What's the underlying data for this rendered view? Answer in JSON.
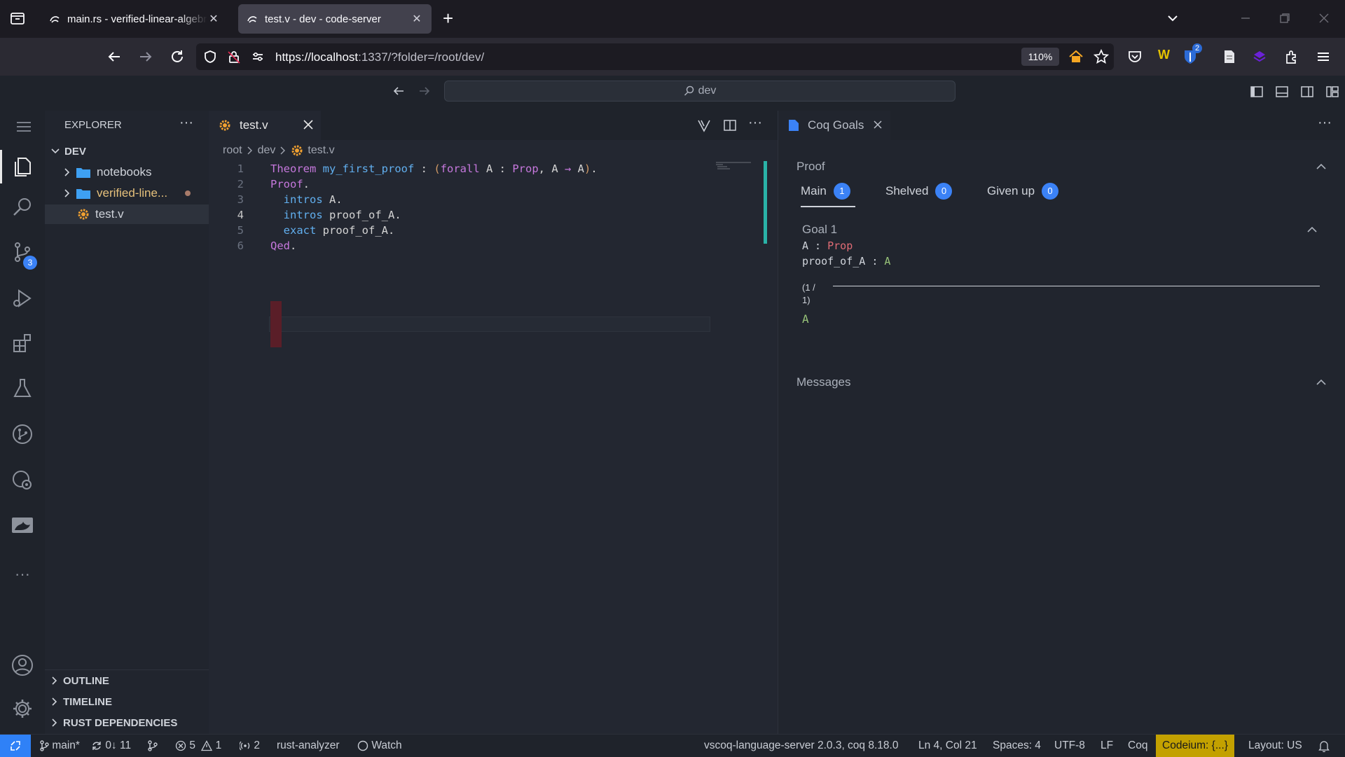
{
  "browser": {
    "tabs": [
      {
        "title": "main.rs - verified-linear-algebra",
        "active": false
      },
      {
        "title": "test.v - dev - code-server",
        "active": true
      }
    ],
    "url_host": "https://localhost",
    "url_rest": ":1337/?folder=/root/dev/",
    "zoom": "110%",
    "extension_badge": "2"
  },
  "command_center": {
    "text": "dev"
  },
  "activity_bar": {
    "items": [
      "explorer",
      "search",
      "source-control",
      "run-debug",
      "extensions",
      "testing",
      "git-graph",
      "remote",
      "coq"
    ],
    "scm_badge": "3"
  },
  "sidebar": {
    "title": "EXPLORER",
    "root_folder": "DEV",
    "tree": [
      {
        "label": "notebooks",
        "type": "folder"
      },
      {
        "label": "verified-line...",
        "type": "folder",
        "modified": true
      },
      {
        "label": "test.v",
        "type": "file",
        "selected": true
      }
    ],
    "sections": [
      "OUTLINE",
      "TIMELINE",
      "RUST DEPENDENCIES"
    ]
  },
  "editor": {
    "tab_label": "test.v",
    "breadcrumb": [
      "root",
      "dev",
      "test.v"
    ],
    "lines": [
      {
        "n": "1",
        "tokens": [
          [
            "kw",
            "Theorem"
          ],
          [
            "pl",
            " "
          ],
          [
            "fn",
            "my_first_proof"
          ],
          [
            "pl",
            " : "
          ],
          [
            "pu",
            "("
          ],
          [
            "kw",
            "forall"
          ],
          [
            "pl",
            " A : "
          ],
          [
            "ty",
            "Prop"
          ],
          [
            "pl",
            ", A "
          ],
          [
            "kw",
            "→"
          ],
          [
            "pl",
            " A"
          ],
          [
            "pu",
            ")"
          ],
          [
            "pl",
            "."
          ]
        ]
      },
      {
        "n": "2",
        "tokens": [
          [
            "kw",
            "Proof"
          ],
          [
            "pl",
            "."
          ]
        ]
      },
      {
        "n": "3",
        "tokens": [
          [
            "pl",
            "  "
          ],
          [
            "fn",
            "intros"
          ],
          [
            "pl",
            " A."
          ]
        ]
      },
      {
        "n": "4",
        "tokens": [
          [
            "pl",
            "  "
          ],
          [
            "fn",
            "intros"
          ],
          [
            "pl",
            " proof_of_A."
          ]
        ]
      },
      {
        "n": "5",
        "tokens": [
          [
            "pl",
            "  "
          ],
          [
            "fn",
            "exact"
          ],
          [
            "pl",
            " proof_of_A."
          ]
        ]
      },
      {
        "n": "6",
        "tokens": [
          [
            "kw",
            "Qed"
          ],
          [
            "pl",
            "."
          ]
        ]
      }
    ]
  },
  "goals_panel": {
    "tab_label": "Coq Goals",
    "proof_title": "Proof",
    "tabs": [
      {
        "label": "Main",
        "count": "1"
      },
      {
        "label": "Shelved",
        "count": "0"
      },
      {
        "label": "Given up",
        "count": "0"
      }
    ],
    "goal_title": "Goal 1",
    "hyp1_name": "A",
    "hyp1_sep": " : ",
    "hyp1_type": "Prop",
    "hyp2_name": "proof_of_A",
    "hyp2_sep": " : ",
    "hyp2_type": "A",
    "counter_line1": "(1 /",
    "counter_line2": "1)",
    "conclusion": "A",
    "messages_title": "Messages"
  },
  "status_bar": {
    "branch": "main*",
    "sync": "0↓ 11",
    "errors": "5",
    "warnings": "1",
    "ports": "2",
    "rust_analyzer": "rust-analyzer",
    "watch": "Watch",
    "language_server": "vscoq-language-server 2.0.3, coq 8.18.0",
    "position": "Ln 4, Col 21",
    "spaces": "Spaces: 4",
    "encoding": "UTF-8",
    "eol": "LF",
    "language": "Coq",
    "codeium": "Codeium: {...}",
    "layout": "Layout: US"
  },
  "colors": {
    "accent_blue": "#3b82f6",
    "codeium_bg": "#c3a100",
    "remote_bg": "#2f81f7",
    "keyword": "#c678dd",
    "function": "#61afef",
    "goal_type": "#e06c75",
    "goal_green": "#98c379"
  }
}
